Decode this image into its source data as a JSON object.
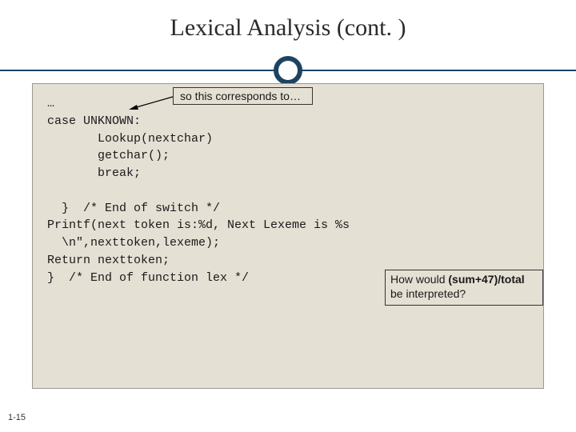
{
  "title": "Lexical Analysis (cont. )",
  "callout1": "so this corresponds to…",
  "code": {
    "l1": "…",
    "l2": "case UNKNOWN:",
    "l3": "       Lookup(nextchar)",
    "l4": "       getchar();",
    "l5": "       break;",
    "l6": "",
    "l7": "  }  /* End of switch */",
    "l8": "Printf(next token is:%d, Next Lexeme is %s",
    "l9": "  \\n\",nexttoken,lexeme);",
    "l10": "Return nexttoken;",
    "l11": "}  /* End of function lex */"
  },
  "callout2_prefix": "How would  ",
  "callout2_bold": "(sum+47)/total",
  "callout2_suffix": "be interpreted?",
  "page_number": "1-15"
}
